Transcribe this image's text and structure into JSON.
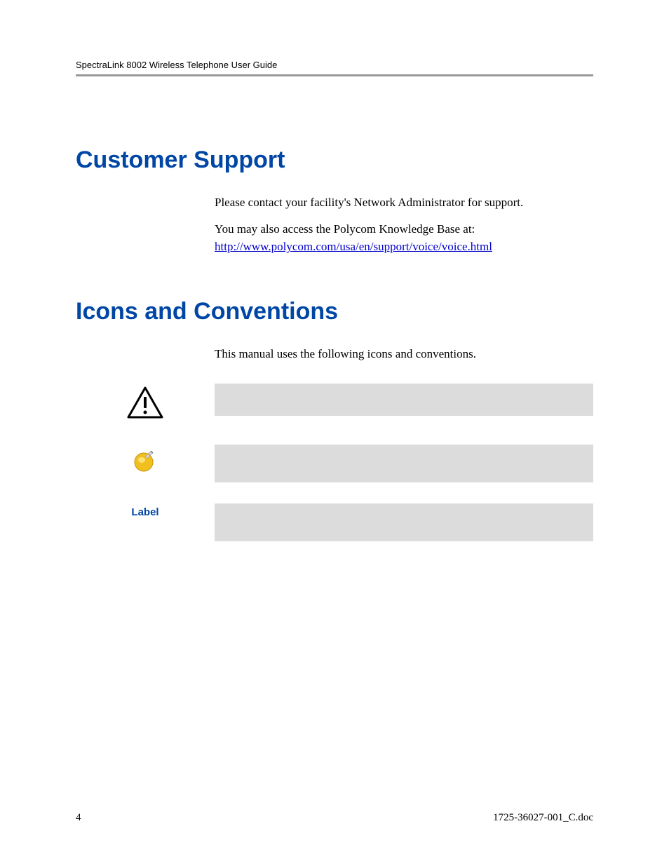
{
  "header": {
    "doc_title": "SpectraLink 8002 Wireless Telephone User Guide"
  },
  "section1": {
    "title": "Customer Support",
    "para1": "Please contact your facility's Network Administrator for support.",
    "para2_prefix": "You may also access the Polycom Knowledge Base at: ",
    "link_text": "http://www.polycom.com/usa/en/support/voice/voice.html"
  },
  "section2": {
    "title": "Icons and Conventions",
    "intro": "This manual uses the following icons and conventions.",
    "label_text": "Label"
  },
  "footer": {
    "page_number": "4",
    "doc_id": "1725-36027-001_C.doc"
  }
}
